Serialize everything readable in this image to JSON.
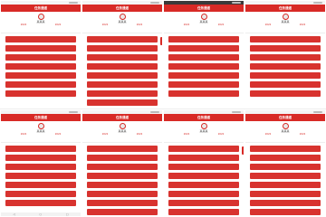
{
  "screens": [
    {
      "title": "任务通道",
      "name": "某某某",
      "stat_left": "2022",
      "stat_right": "2022",
      "items": [
        "",
        "",
        "",
        "",
        "",
        "",
        ""
      ]
    },
    {
      "title": "任务通道",
      "name": "某某某",
      "stat_left": "2022",
      "stat_right": "2022",
      "items": [
        "",
        "",
        "",
        "",
        "",
        "",
        "",
        ""
      ]
    },
    {
      "title": "任务通道",
      "name": "某某某",
      "stat_left": "2022",
      "stat_right": "2022",
      "items": [
        "",
        "",
        "",
        "",
        "",
        "",
        ""
      ]
    },
    {
      "title": "任务通道",
      "name": "某某某",
      "stat_left": "2022",
      "stat_right": "2022",
      "items": [
        "",
        "",
        "",
        "",
        "",
        "",
        ""
      ]
    },
    {
      "title": "任务通道",
      "name": "某某某",
      "stat_left": "2022",
      "stat_right": "2022",
      "items": [
        "",
        "",
        "",
        "",
        "",
        "",
        "",
        ""
      ]
    },
    {
      "title": "任务通道",
      "name": "某某某",
      "stat_left": "2022",
      "stat_right": "2022",
      "items": [
        "",
        "",
        "",
        "",
        "",
        "",
        "",
        ""
      ]
    },
    {
      "title": "任务通道",
      "name": "某某某",
      "stat_left": "2022",
      "stat_right": "2022",
      "items": [
        "",
        "",
        "",
        "",
        "",
        "",
        "",
        ""
      ]
    },
    {
      "title": "任务通道",
      "name": "某某某",
      "stat_left": "2022",
      "stat_right": "2022",
      "items": [
        "",
        "",
        "",
        "",
        "",
        "",
        "",
        ""
      ]
    }
  ],
  "colors": {
    "accent": "#d82a26",
    "button": "#d8332f"
  },
  "icons": {
    "back": "back-icon",
    "home": "home-icon",
    "recent": "recent-apps-icon"
  }
}
